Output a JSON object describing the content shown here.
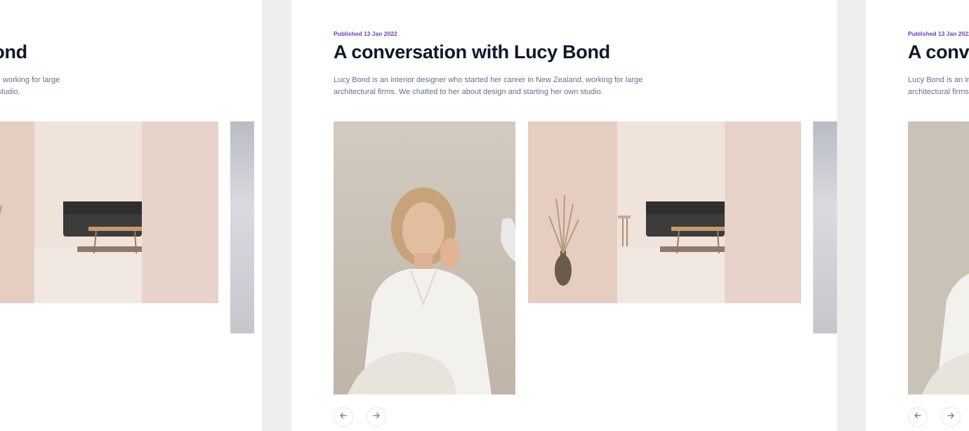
{
  "article": {
    "published": "Published 13 Jan 2022",
    "title": "A conversation with Lucy Bond",
    "description": "Lucy Bond is an interior designer who started her career in New Zealand, working for large architectural firms. We chatted to her about design and starting her own studio."
  },
  "gallery": {
    "images": [
      {
        "name": "portrait-photo",
        "subject": "woman in white shirt portrait"
      },
      {
        "name": "living-room-photo",
        "subject": "pink living room with sofa and vase"
      },
      {
        "name": "next-photo-preview",
        "subject": "partial next image"
      }
    ]
  },
  "controls": {
    "prev_icon": "arrow-left-icon",
    "next_icon": "arrow-right-icon"
  },
  "colors": {
    "accent": "#6941c6",
    "title": "#101828",
    "body": "#667085",
    "page_bg": "#eeeeee",
    "card_bg": "#ffffff"
  }
}
